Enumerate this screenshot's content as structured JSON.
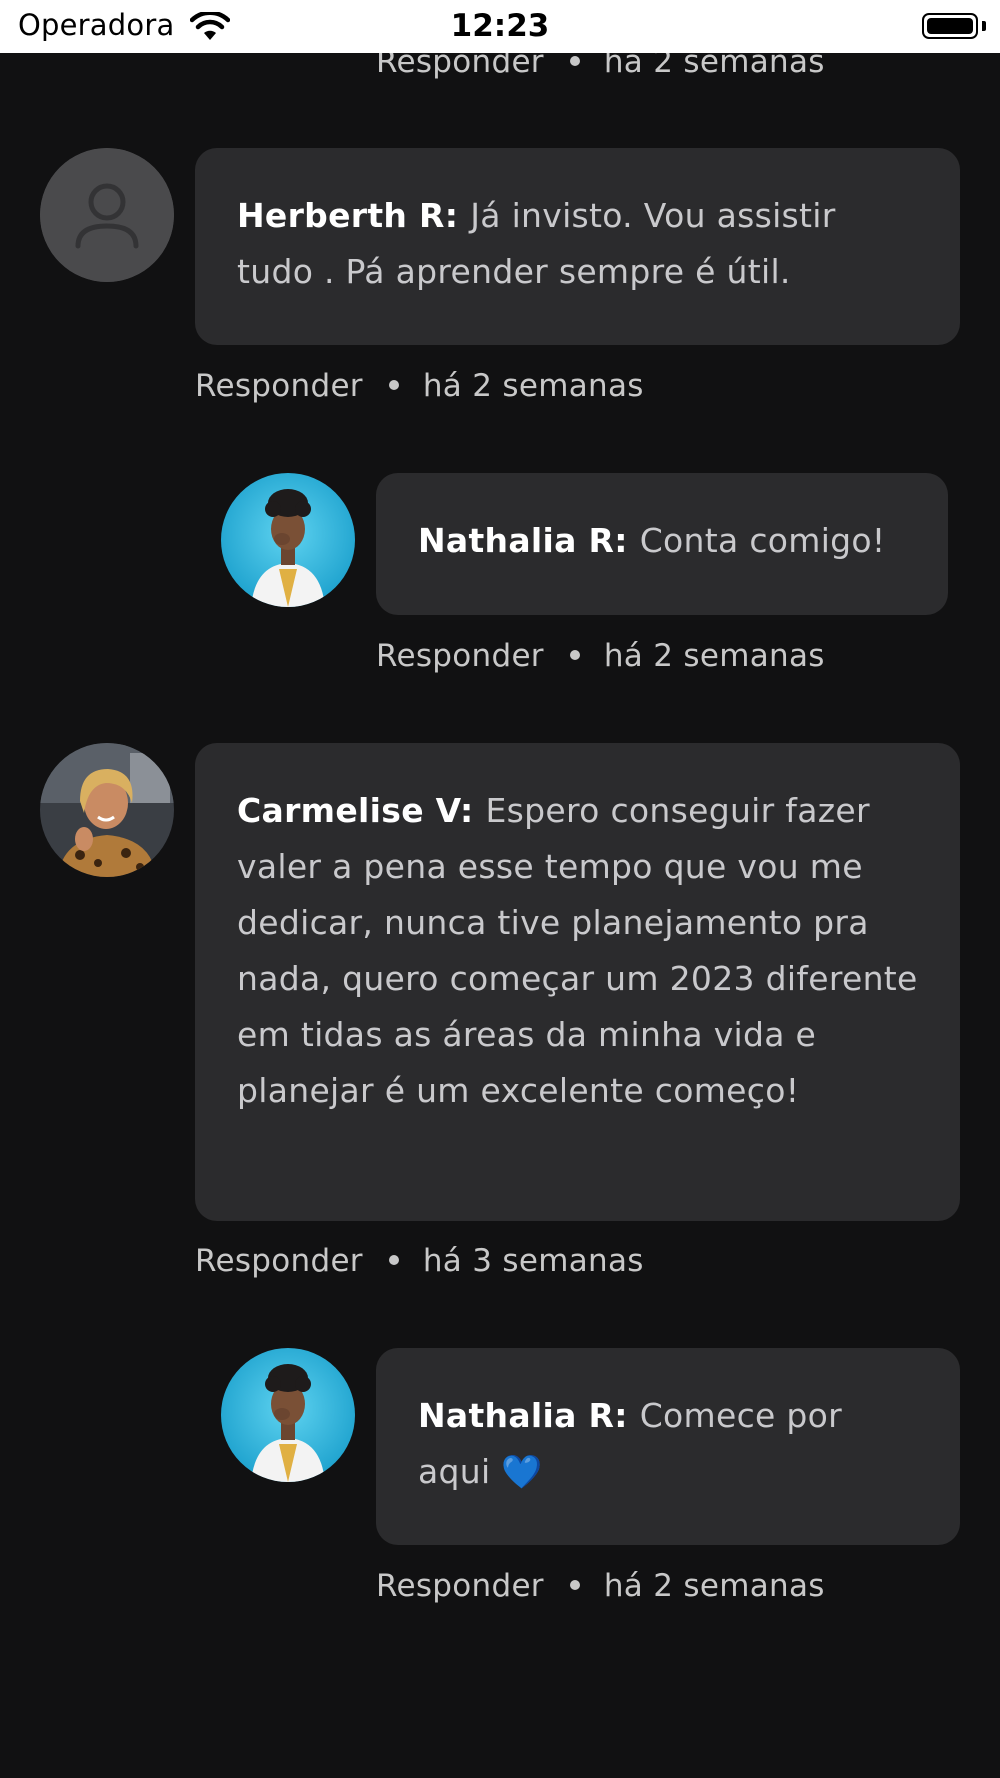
{
  "status_bar": {
    "carrier": "Operadora",
    "time": "12:23",
    "icons": [
      "wifi-icon",
      "battery-icon"
    ]
  },
  "top_meta": {
    "reply_label": "Responder",
    "time_ago": "há 2 semanas"
  },
  "comments": [
    {
      "author": "Herberth R:",
      "text": "Já invisto. Vou assistir tudo . Pá aprender sempre é útil.",
      "reply_label": "Responder",
      "time_ago": "há 2 semanas",
      "avatar": "default-user-icon",
      "replies": [
        {
          "author": "Nathalia R:",
          "text": "Conta comigo!",
          "reply_label": "Responder",
          "time_ago": "há 2 semanas",
          "avatar": "nathalia-photo"
        }
      ]
    },
    {
      "author": "Carmelise V:",
      "text": "Espero conseguir fazer valer a pena esse tempo que vou me dedicar, nunca tive planejamento pra nada, quero começar um 2023 diferente em tidas as áreas da minha vida e planejar é um excelente começo!",
      "reply_label": "Responder",
      "time_ago": "há 3 semanas",
      "avatar": "carmelise-photo",
      "replies": [
        {
          "author": "Nathalia R:",
          "text": "Comece por aqui 💙",
          "reply_label": "Responder",
          "time_ago": "há 2 semanas",
          "avatar": "nathalia-photo"
        }
      ]
    }
  ],
  "colors": {
    "background": "#111112",
    "bubble": "#2b2b2d",
    "author_text": "#ffffff",
    "comment_text": "#c9c9cc",
    "meta_text": "#c8c8c8"
  }
}
